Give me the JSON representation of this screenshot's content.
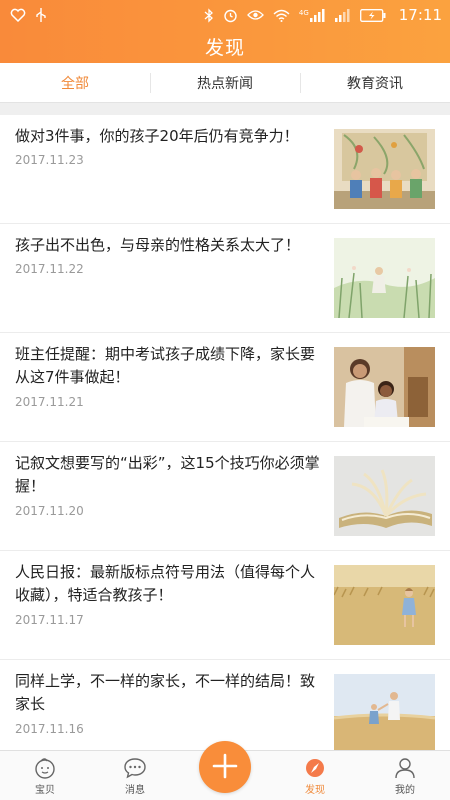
{
  "status_bar": {
    "time": "17:11",
    "signal_label": "4G"
  },
  "header": {
    "title": "发现"
  },
  "tabs": [
    {
      "label": "全部",
      "active": true
    },
    {
      "label": "热点新闻",
      "active": false
    },
    {
      "label": "教育资讯",
      "active": false
    }
  ],
  "articles": [
    {
      "title": "做对3件事，你的孩子20年后仍有竞争力！",
      "date": "2017.11.23",
      "image": "children-at-wall"
    },
    {
      "title": "孩子出不出色，与母亲的性格关系太大了！",
      "date": "2017.11.22",
      "image": "painted-child-in-meadow"
    },
    {
      "title": "班主任提醒：期中考试孩子成绩下降，家长要从这7件事做起！",
      "date": "2017.11.21",
      "image": "mother-helping-child-study"
    },
    {
      "title": "记叙文想要写的“出彩”，这15个技巧你必须掌握！",
      "date": "2017.11.20",
      "image": "open-book"
    },
    {
      "title": "人民日报：最新版标点符号用法（值得每个人收藏），特适合教孩子！",
      "date": "2017.11.17",
      "image": "girl-in-wheat-field"
    },
    {
      "title": "同样上学，不一样的家长，不一样的结局！致家长",
      "date": "2017.11.16",
      "image": "parent-and-child-in-field"
    }
  ],
  "bottom_nav": [
    {
      "label": "宝贝",
      "icon": "baby-icon",
      "active": false
    },
    {
      "label": "消息",
      "icon": "chat-bubble-icon",
      "active": false
    },
    {
      "label": "",
      "icon": "plus-icon",
      "active": false
    },
    {
      "label": "发现",
      "icon": "compass-icon",
      "active": true
    },
    {
      "label": "我的",
      "icon": "user-icon",
      "active": false
    }
  ],
  "colors": {
    "accent": "#f98a3a",
    "accent_light": "#fba23f",
    "date_gray": "#9a9a9a"
  }
}
